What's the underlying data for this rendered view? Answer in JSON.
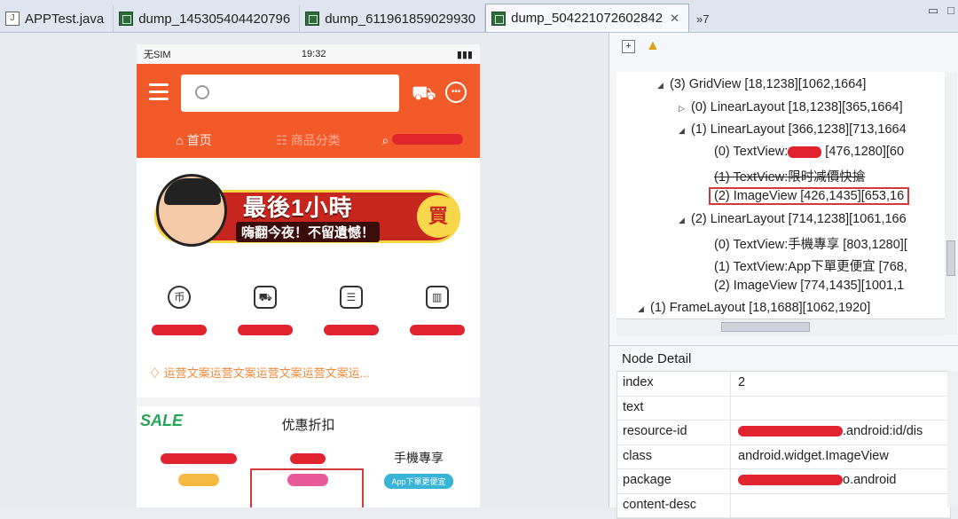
{
  "tabs": [
    {
      "label": "APPTest.java",
      "icon": "java-file-icon"
    },
    {
      "label": "dump_1453054044207​96",
      "icon": "dump-icon"
    },
    {
      "label": "dump_611961859029930",
      "icon": "dump-icon"
    },
    {
      "label": "dump_504221072602842",
      "icon": "dump-icon",
      "active": true
    }
  ],
  "tab_overflow": "»7",
  "phone": {
    "status": {
      "carrier": "无SIM",
      "time": "19:32"
    },
    "nav": {
      "home": "首页",
      "category": "商品分类"
    },
    "banner": {
      "headline": "最後1小時",
      "subline": "嗨翻今夜！不留遺憾！",
      "buy": "買"
    },
    "notice": "运营文案运营文案运营文案运营文案运...",
    "sale": {
      "badge": "SALE",
      "title": "优惠折扣",
      "col3_title": "手機專享",
      "col3_pill": "App下單更便宜"
    }
  },
  "tree": {
    "nodes": [
      {
        "text": "(3) GridView [18,1238][1062,1664]",
        "toggle": "◢"
      },
      {
        "text": "(0) LinearLayout [18,1238][365,1664]",
        "toggle": "▷"
      },
      {
        "text": "(1) LinearLayout [366,1238][713,1664",
        "toggle": "◢"
      },
      {
        "text": "(0) TextView:",
        "suffix": " [476,1280][60"
      },
      {
        "text": "(1) TextView:限时减價快搶"
      },
      {
        "text": "(2) ImageView [426,1435][653,16",
        "selected": true
      },
      {
        "text": "(2) LinearLayout [714,1238][1061,166",
        "toggle": "◢"
      },
      {
        "text": "(0) TextView:手機專享 [803,1280]["
      },
      {
        "text": "(1) TextView:App下單更便宜 [768,"
      },
      {
        "text": "(2) ImageView [774,1435][1001,1"
      },
      {
        "text": "(1) FrameLayout [18,1688][1062,1920]",
        "toggle": "◢"
      }
    ]
  },
  "node_detail": {
    "heading": "Node Detail",
    "rows": [
      {
        "key": "index",
        "value": "2"
      },
      {
        "key": "text",
        "value": ""
      },
      {
        "key": "resource-id",
        "value": ".android:id/dis"
      },
      {
        "key": "class",
        "value": "android.widget.ImageView"
      },
      {
        "key": "package",
        "value": "o.android"
      },
      {
        "key": "content-desc",
        "value": ""
      }
    ]
  }
}
